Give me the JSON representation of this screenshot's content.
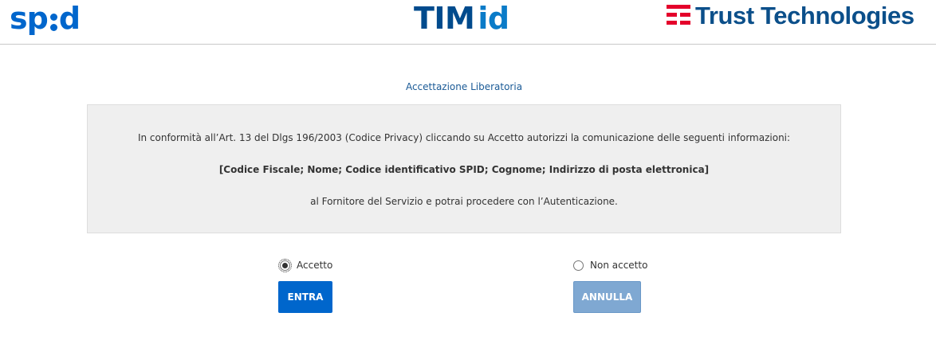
{
  "header": {
    "spid_logo": {
      "before": "sp",
      "after": "d"
    },
    "tim_logo": {
      "main": "TIM",
      "suffix": "id"
    },
    "trust_logo": {
      "text": "Trust Technologies"
    }
  },
  "main": {
    "title": "Accettazione Liberatoria",
    "consent": {
      "line1": "In conformità all’Art. 13 del Dlgs 196/2003 (Codice Privacy) cliccando su Accetto autorizzi la comunicazione delle seguenti informazioni:",
      "line2": "[Codice Fiscale; Nome; Codice identificativo SPID; Cognome; Indirizzo di posta elettronica]",
      "line3": "al Fornitore del Servizio e potrai procedere con l’Autenticazione."
    },
    "options": {
      "accept_label": "Accetto",
      "accept_checked": true,
      "decline_label": "Non accetto",
      "decline_checked": false
    },
    "buttons": {
      "enter_label": "ENTRA",
      "cancel_label": "ANNULLA",
      "cancel_disabled": true
    }
  },
  "colors": {
    "brand_blue": "#0066cc",
    "tim_dark_blue": "#004b8d",
    "trust_red": "#e4002b",
    "disabled_blue": "#7fa8d2",
    "panel_gray": "#efefef"
  },
  "icons": {
    "spid": "spid-logo-icon",
    "trust": "trust-technologies-mark-icon"
  }
}
